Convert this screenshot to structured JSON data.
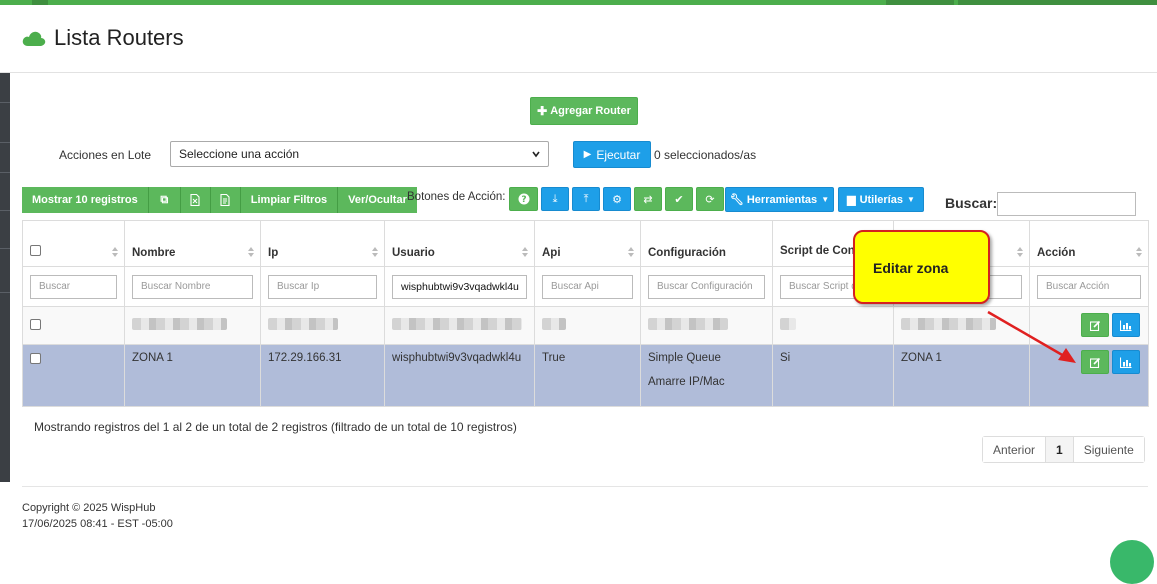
{
  "page": {
    "title": "Lista Routers",
    "add_button": "Agregar Router"
  },
  "batch": {
    "label": "Acciones en Lote",
    "select_value": "Seleccione una acción",
    "execute_label": "Ejecutar",
    "selected_count": "0 seleccionados/as"
  },
  "toolbar": {
    "show_records": "Mostrar 10 registros",
    "clear_filters": "Limpiar Filtros",
    "show_hide": "Ver/Ocultar",
    "action_buttons_label": "Botones de Acción:",
    "tools": "Herramientas",
    "utilities": "Utilerías",
    "search_label": "Buscar:"
  },
  "table": {
    "columns": [
      "Nombre",
      "Ip",
      "Usuario",
      "Api",
      "Configuración",
      "Script de Conexión",
      "Acción"
    ],
    "filters": [
      "Buscar",
      "Buscar Nombre",
      "Buscar Ip",
      "wisphubtwi9v3vqadwkl4u",
      "Buscar Api",
      "Buscar Configuración",
      "Buscar Script d",
      "Buscar Acción"
    ],
    "rows": [
      {
        "nombre": "ZONA 1",
        "ip": "172.29.166.31",
        "usuario": "wisphubtwi9v3vqadwkl4u",
        "api": "True",
        "config_1": "Simple Queue",
        "config_2": "Amarre IP/Mac",
        "script": "Si",
        "zona": "ZONA 1"
      }
    ]
  },
  "callout": {
    "text": "Editar zona"
  },
  "info": "Mostrando registros del 1 al 2 de un total de 2 registros (filtrado de un total de 10 registros)",
  "pagination": {
    "prev": "Anterior",
    "current": "1",
    "next": "Siguiente"
  },
  "footer": {
    "copyright": "Copyright © 2025 WispHub",
    "datetime": "17/06/2025 08:41 - EST -05:00"
  },
  "colors": {
    "green": "#5cb85c",
    "blue": "#1e9fe8",
    "selected_row": "#b0bcd9",
    "callout": "#ffff00",
    "arrow": "#e02020"
  },
  "icons": [
    "cloud-icon",
    "plus-icon",
    "play-icon",
    "copy-icon",
    "csv-icon",
    "pdf-icon",
    "question-icon",
    "download-icon",
    "upload-icon",
    "gears-icon",
    "exchange-icon",
    "check-icon",
    "refresh-icon",
    "wrench-icon",
    "briefcase-icon",
    "edit-icon",
    "chart-icon"
  ]
}
